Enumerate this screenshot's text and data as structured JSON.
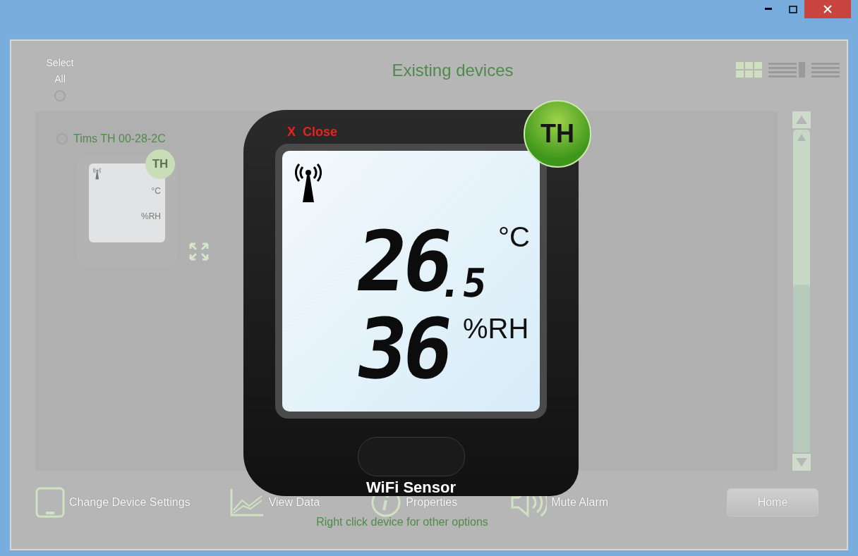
{
  "header": {
    "select_all": {
      "label": "Select All",
      "selected": false
    },
    "title": "Existing devices",
    "view_modes": [
      {
        "kind": "grid",
        "selected": true
      },
      {
        "kind": "detail",
        "selected": false
      },
      {
        "kind": "list",
        "selected": false
      }
    ]
  },
  "devices": [
    {
      "name": "Tims TH 00-28-2C",
      "selected": false,
      "badge": "TH",
      "units": [
        "°C",
        "%RH"
      ]
    }
  ],
  "toolbar": [
    {
      "kind": "tablet",
      "label": "Change Device Settings"
    },
    {
      "kind": "chart",
      "label": "View Data"
    },
    {
      "kind": "info",
      "label": "Properties"
    },
    {
      "kind": "speaker",
      "label": "Mute Alarm"
    }
  ],
  "home_button": "Home",
  "hint": "Right click device for other options",
  "modal": {
    "close": "X  Close",
    "badge": "TH",
    "temperature_whole": "26",
    "temperature_fraction": ".5",
    "temperature_unit": "°C",
    "humidity": "36",
    "humidity_unit": "%RH",
    "label": "WiFi Sensor"
  }
}
